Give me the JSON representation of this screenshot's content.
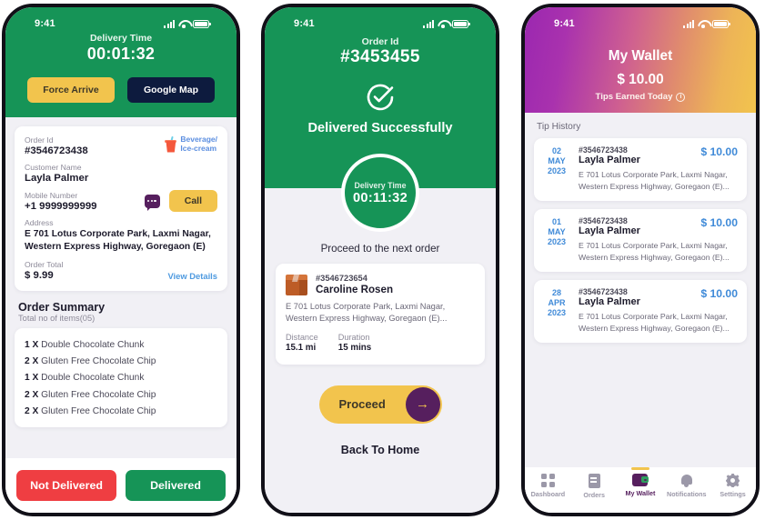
{
  "status_bar": {
    "time": "9:41",
    "signal_icon": "signal-bars-icon",
    "wifi_icon": "wifi-icon",
    "battery_icon": "battery-icon"
  },
  "screen1": {
    "header": {
      "delivery_time_label": "Delivery Time",
      "delivery_time_value": "00:01:32",
      "force_arrive_label": "Force Arrive",
      "google_map_label": "Google Map"
    },
    "order_card": {
      "order_id_label": "Order Id",
      "order_id_value": "#3546723438",
      "category_line1": "Beverage/",
      "category_line2": "Ice-cream",
      "customer_name_label": "Customer Name",
      "customer_name_value": "Layla Palmer",
      "mobile_label": "Mobile Number",
      "mobile_value": "+1 9999999999",
      "call_label": "Call",
      "address_label": "Address",
      "address_line1": "E 701 Lotus Corporate Park, Laxmi Nagar,",
      "address_line2": "Western Express Highway, Goregaon (E)",
      "order_total_label": "Order Total",
      "order_total_value": "$ 9.99",
      "view_details_label": "View Details"
    },
    "summary": {
      "title": "Order Summary",
      "subtitle": "Total no of items(05)",
      "items": [
        {
          "qty": "1 X",
          "name": "Double Chocolate Chunk"
        },
        {
          "qty": "2 X",
          "name": "Gluten Free Chocolate Chip"
        },
        {
          "qty": "1 X",
          "name": "Double Chocolate Chunk"
        },
        {
          "qty": "2 X",
          "name": "Gluten Free Chocolate Chip"
        },
        {
          "qty": "2 X",
          "name": "Gluten Free Chocolate Chip"
        }
      ]
    },
    "footer": {
      "not_delivered_label": "Not Delivered",
      "delivered_label": "Delivered"
    }
  },
  "screen2": {
    "header": {
      "order_id_label": "Order Id",
      "order_id_value": "#3453455",
      "success_text": "Delivered Successfully",
      "delivery_time_label": "Delivery Time",
      "delivery_time_value": "00:11:32"
    },
    "proceed_text": "Proceed to the next order",
    "next_order": {
      "order_id": "#3546723654",
      "name": "Caroline Rosen",
      "address_line1": "E 701 Lotus Corporate Park, Laxmi Nagar,",
      "address_line2": "Western Express Highway, Goregaon (E)...",
      "distance_label": "Distance",
      "distance_value": "15.1 mi",
      "duration_label": "Duration",
      "duration_value": "15 mins"
    },
    "proceed_button": "Proceed",
    "arrow_glyph": "→",
    "back_home": "Back To Home"
  },
  "screen3": {
    "header": {
      "title": "My Wallet",
      "amount": "$ 10.00",
      "subtitle": "Tips Earned Today",
      "info_glyph": "i"
    },
    "tip_history_label": "Tip History",
    "tips": [
      {
        "day": "02",
        "month": "MAY",
        "year": "2023",
        "order_id": "#3546723438",
        "name": "Layla Palmer",
        "amount": "$ 10.00",
        "address_line1": "E 701 Lotus Corporate Park, Laxmi Nagar,",
        "address_line2": "Western Express Highway, Goregaon (E)..."
      },
      {
        "day": "01",
        "month": "MAY",
        "year": "2023",
        "order_id": "#3546723438",
        "name": "Layla Palmer",
        "amount": "$ 10.00",
        "address_line1": "E 701 Lotus Corporate Park, Laxmi Nagar,",
        "address_line2": "Western Express Highway, Goregaon (E)..."
      },
      {
        "day": "28",
        "month": "APR",
        "year": "2023",
        "order_id": "#3546723438",
        "name": "Layla Palmer",
        "amount": "$ 10.00",
        "address_line1": "E 701 Lotus Corporate Park, Laxmi Nagar,",
        "address_line2": "Western Express Highway, Goregaon (E)..."
      }
    ],
    "nav": [
      {
        "label": "Dashboard",
        "icon": "dashboard-grid-icon",
        "active": false
      },
      {
        "label": "Orders",
        "icon": "document-icon",
        "active": false
      },
      {
        "label": "My Wallet",
        "icon": "wallet-icon",
        "active": true
      },
      {
        "label": "Notifications",
        "icon": "bell-icon",
        "active": false
      },
      {
        "label": "Settings",
        "icon": "gear-icon",
        "active": false
      }
    ]
  },
  "colors": {
    "green": "#169457",
    "yellow": "#f2c44d",
    "navy": "#0d1b3e",
    "red": "#ef3e42",
    "purple": "#561f5e",
    "blue_link": "#4e9ae0",
    "tip_blue": "#3f8ad8"
  }
}
